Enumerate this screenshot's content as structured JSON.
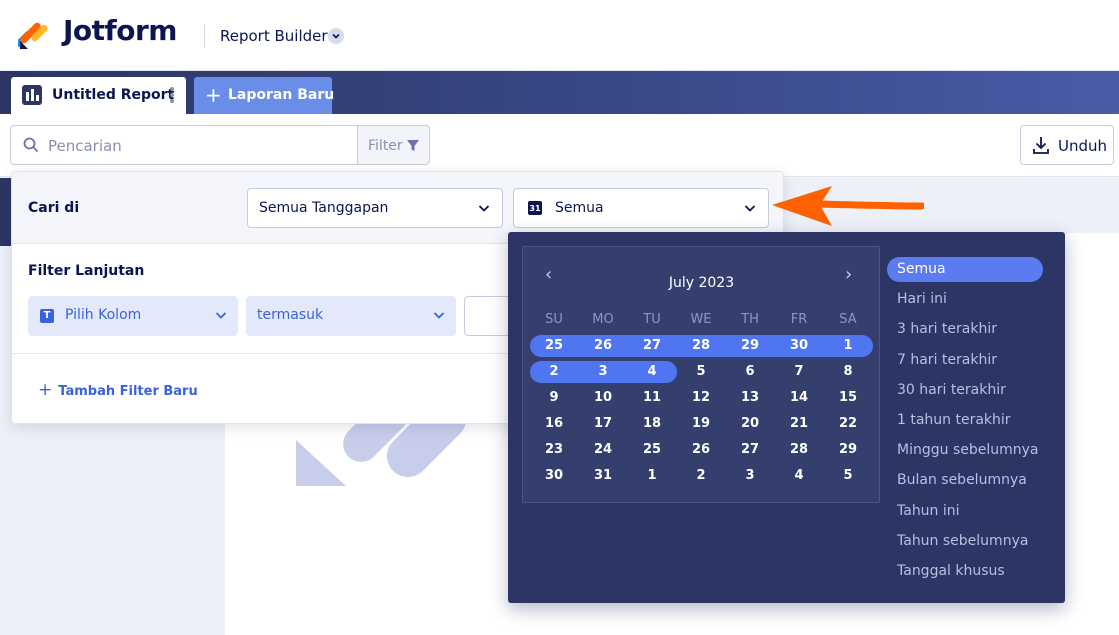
{
  "header": {
    "brand": "Jotform",
    "product": "Report Builder"
  },
  "tabs": {
    "active_label": "Untitled Report",
    "new_label": "Laporan Baru"
  },
  "toolbar": {
    "search_placeholder": "Pencarian",
    "filter_label": "Filter",
    "download_label": "Unduh"
  },
  "filter_panel": {
    "search_in_label": "Cari di",
    "responses_select": "Semua Tanggapan",
    "date_select": "Semua",
    "date_icon_text": "31",
    "advanced_label": "Filter Lanjutan",
    "column_select": "Pilih Kolom",
    "column_icon_text": "T",
    "operator_select": "termasuk",
    "add_filter_label": "Tambah Filter Baru"
  },
  "calendar": {
    "month_title": "July 2023",
    "prev": "‹",
    "next": "›",
    "weekdays": [
      "SU",
      "MO",
      "TU",
      "WE",
      "TH",
      "FR",
      "SA"
    ],
    "weeks": [
      [
        "25",
        "26",
        "27",
        "28",
        "29",
        "30",
        "1"
      ],
      [
        "2",
        "3",
        "4",
        "5",
        "6",
        "7",
        "8"
      ],
      [
        "9",
        "10",
        "11",
        "12",
        "13",
        "14",
        "15"
      ],
      [
        "16",
        "17",
        "18",
        "19",
        "20",
        "21",
        "22"
      ],
      [
        "23",
        "24",
        "25",
        "26",
        "27",
        "28",
        "29"
      ],
      [
        "30",
        "31",
        "1",
        "2",
        "3",
        "4",
        "5"
      ]
    ]
  },
  "quick_ranges": {
    "selected": "Semua",
    "items": [
      "Semua",
      "Hari ini",
      "3 hari terakhir",
      "7 hari terakhir",
      "30 hari terakhir",
      "1 tahun terakhir",
      "Minggu sebelumnya",
      "Bulan sebelumnya",
      "Tahun ini",
      "Tahun sebelumnya",
      "Tanggal khusus"
    ]
  },
  "colors": {
    "navy": "#0a1551",
    "accent_blue": "#4f76f0",
    "dropdown_bg": "#2c3563",
    "arrow_orange": "#ff6100"
  }
}
